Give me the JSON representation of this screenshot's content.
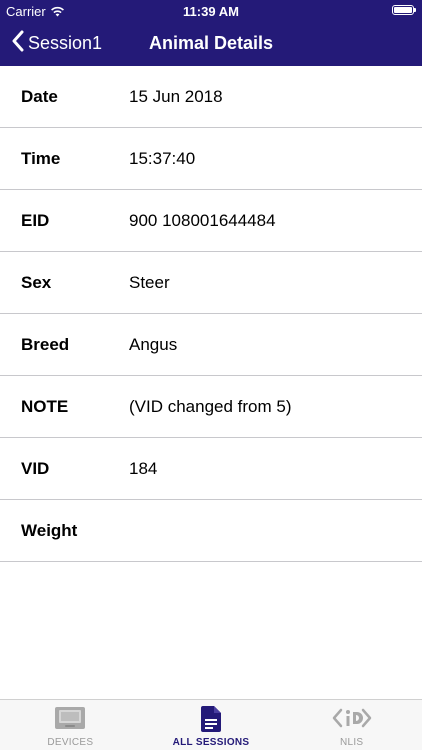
{
  "status_bar": {
    "carrier": "Carrier",
    "time": "11:39 AM"
  },
  "nav": {
    "back_label": "Session1",
    "title": "Animal Details"
  },
  "details": [
    {
      "label": "Date",
      "value": "15 Jun 2018"
    },
    {
      "label": "Time",
      "value": "15:37:40"
    },
    {
      "label": "EID",
      "value": "900 108001644484"
    },
    {
      "label": "Sex",
      "value": "Steer"
    },
    {
      "label": "Breed",
      "value": "Angus"
    },
    {
      "label": "NOTE",
      "value": "(VID changed from 5)"
    },
    {
      "label": "VID",
      "value": "184"
    },
    {
      "label": "Weight",
      "value": ""
    }
  ],
  "tabs": [
    {
      "label": "DEVICES",
      "icon": "device-icon",
      "active": false
    },
    {
      "label": "ALL SESSIONS",
      "icon": "document-icon",
      "active": true
    },
    {
      "label": "NLIS",
      "icon": "nlis-logo-icon",
      "active": false
    }
  ],
  "colors": {
    "header_bg": "#241a78",
    "active_tab": "#241a78",
    "inactive_tab": "#9a9a9a"
  }
}
